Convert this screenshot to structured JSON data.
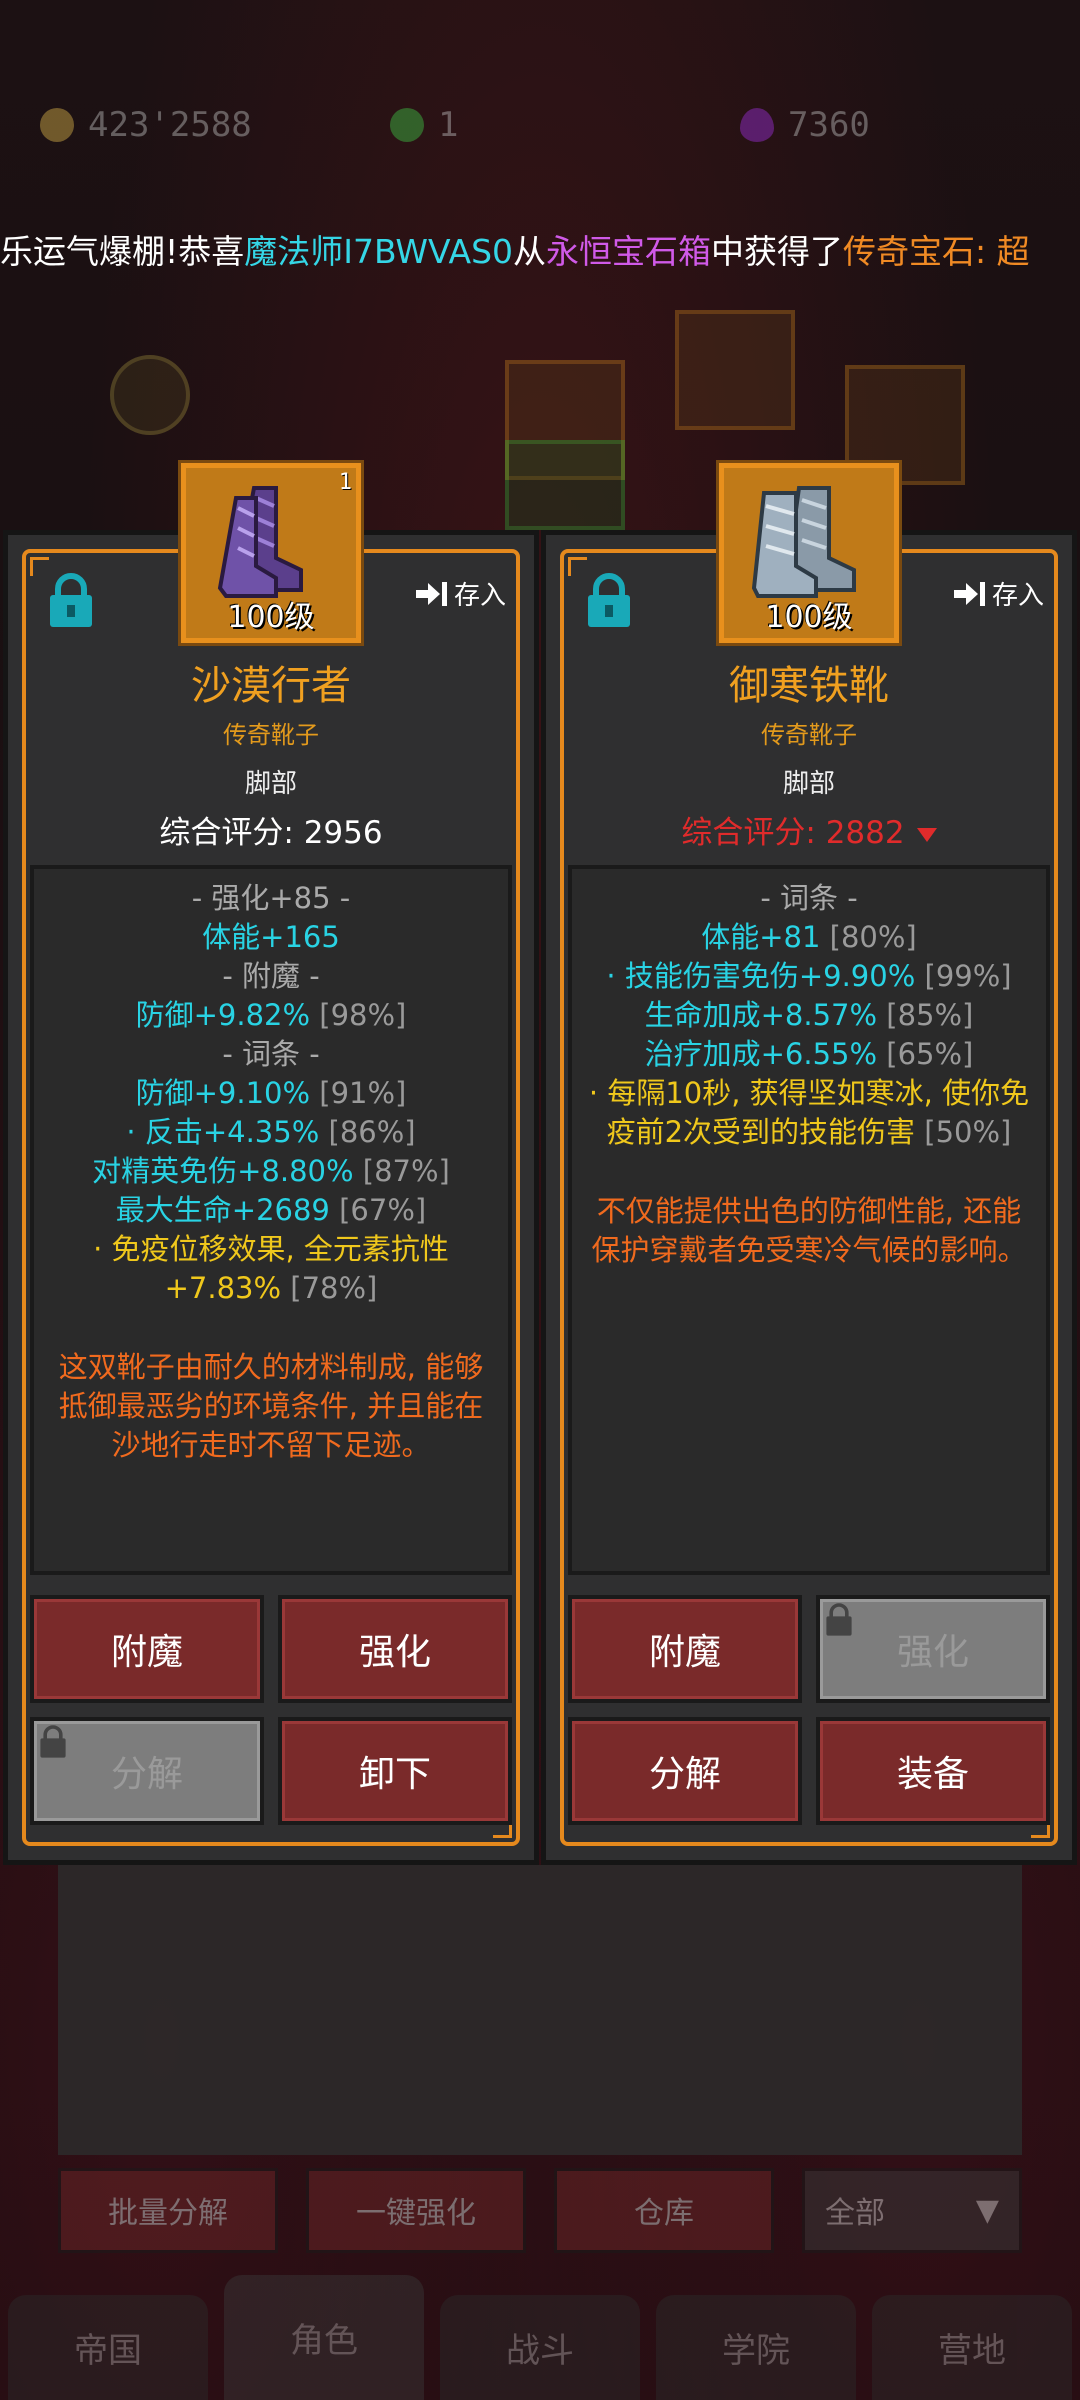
{
  "currencies": [
    {
      "name": "gold-coin-icon",
      "value": "423'2588"
    },
    {
      "name": "green-gem-icon",
      "value": "1"
    },
    {
      "name": "purple-crystal-icon",
      "value": "7360"
    }
  ],
  "ticker": {
    "part1": "乐运气爆棚!恭喜",
    "player": "魔法师I7BWVAS0",
    "part2": "从",
    "chest": "永恒宝石箱",
    "part3": "中获得了",
    "reward": "传奇宝石: 超"
  },
  "left": {
    "store_label": "存入",
    "level": "100级",
    "count": "1",
    "name": "沙漠行者",
    "rarity": "传奇靴子",
    "slot": "脚部",
    "score": "综合评分: 2956",
    "stats": [
      {
        "t": "hdr",
        "text": "- 强化+85 -"
      },
      {
        "t": "c",
        "text": "体能+165"
      },
      {
        "t": "hdr",
        "text": "- 附魔 -"
      },
      {
        "t": "c",
        "text": "防御+9.82%",
        "br": "[98%]"
      },
      {
        "t": "hdr",
        "text": "- 词条 -"
      },
      {
        "t": "c",
        "text": "防御+9.10%",
        "br": "[91%]"
      },
      {
        "t": "c",
        "text": "· 反击+4.35%",
        "br": "[86%]"
      },
      {
        "t": "c",
        "text": "对精英免伤+8.80%",
        "br": "[87%]"
      },
      {
        "t": "c",
        "text": "最大生命+2689",
        "br": "[67%]"
      },
      {
        "t": "y",
        "text": "· 免疫位移效果, 全元素抗性+7.83%",
        "br": "[78%]"
      }
    ],
    "desc": "这双靴子由耐久的材料制成, 能够抵御最恶劣的环境条件, 并且能在沙地行走时不留下足迹。",
    "buttons": [
      {
        "label": "附魔",
        "disabled": false
      },
      {
        "label": "强化",
        "disabled": false
      },
      {
        "label": "分解",
        "disabled": true
      },
      {
        "label": "卸下",
        "disabled": false
      }
    ]
  },
  "right": {
    "store_label": "存入",
    "level": "100级",
    "name": "御寒铁靴",
    "rarity": "传奇靴子",
    "slot": "脚部",
    "score": "综合评分: 2882",
    "stats": [
      {
        "t": "hdr",
        "text": "- 词条 -"
      },
      {
        "t": "c",
        "text": "体能+81",
        "br": "[80%]"
      },
      {
        "t": "c",
        "text": "· 技能伤害免伤+9.90%",
        "br": "[99%]"
      },
      {
        "t": "c",
        "text": "生命加成+8.57%",
        "br": "[85%]"
      },
      {
        "t": "c",
        "text": "治疗加成+6.55%",
        "br": "[65%]"
      },
      {
        "t": "y",
        "text": "· 每隔10秒, 获得坚如寒冰, 使你免疫前2次受到的技能伤害",
        "br": "[50%]"
      }
    ],
    "desc": "不仅能提供出色的防御性能, 还能保护穿戴者免受寒冷气候的影响。",
    "buttons": [
      {
        "label": "附魔",
        "disabled": false
      },
      {
        "label": "强化",
        "disabled": true
      },
      {
        "label": "分解",
        "disabled": false
      },
      {
        "label": "装备",
        "disabled": false
      }
    ]
  },
  "bottom_actions": [
    "批量分解",
    "一键强化",
    "仓库"
  ],
  "filter": "全部",
  "tabs": [
    "帝国",
    "角色",
    "战斗",
    "学院",
    "营地"
  ],
  "colors": {
    "accent": "#e5891d",
    "button": "#7a2a2a",
    "cyan": "#29d3e4",
    "orange_desc": "#f06a1e",
    "red_score": "#e02b2b"
  }
}
